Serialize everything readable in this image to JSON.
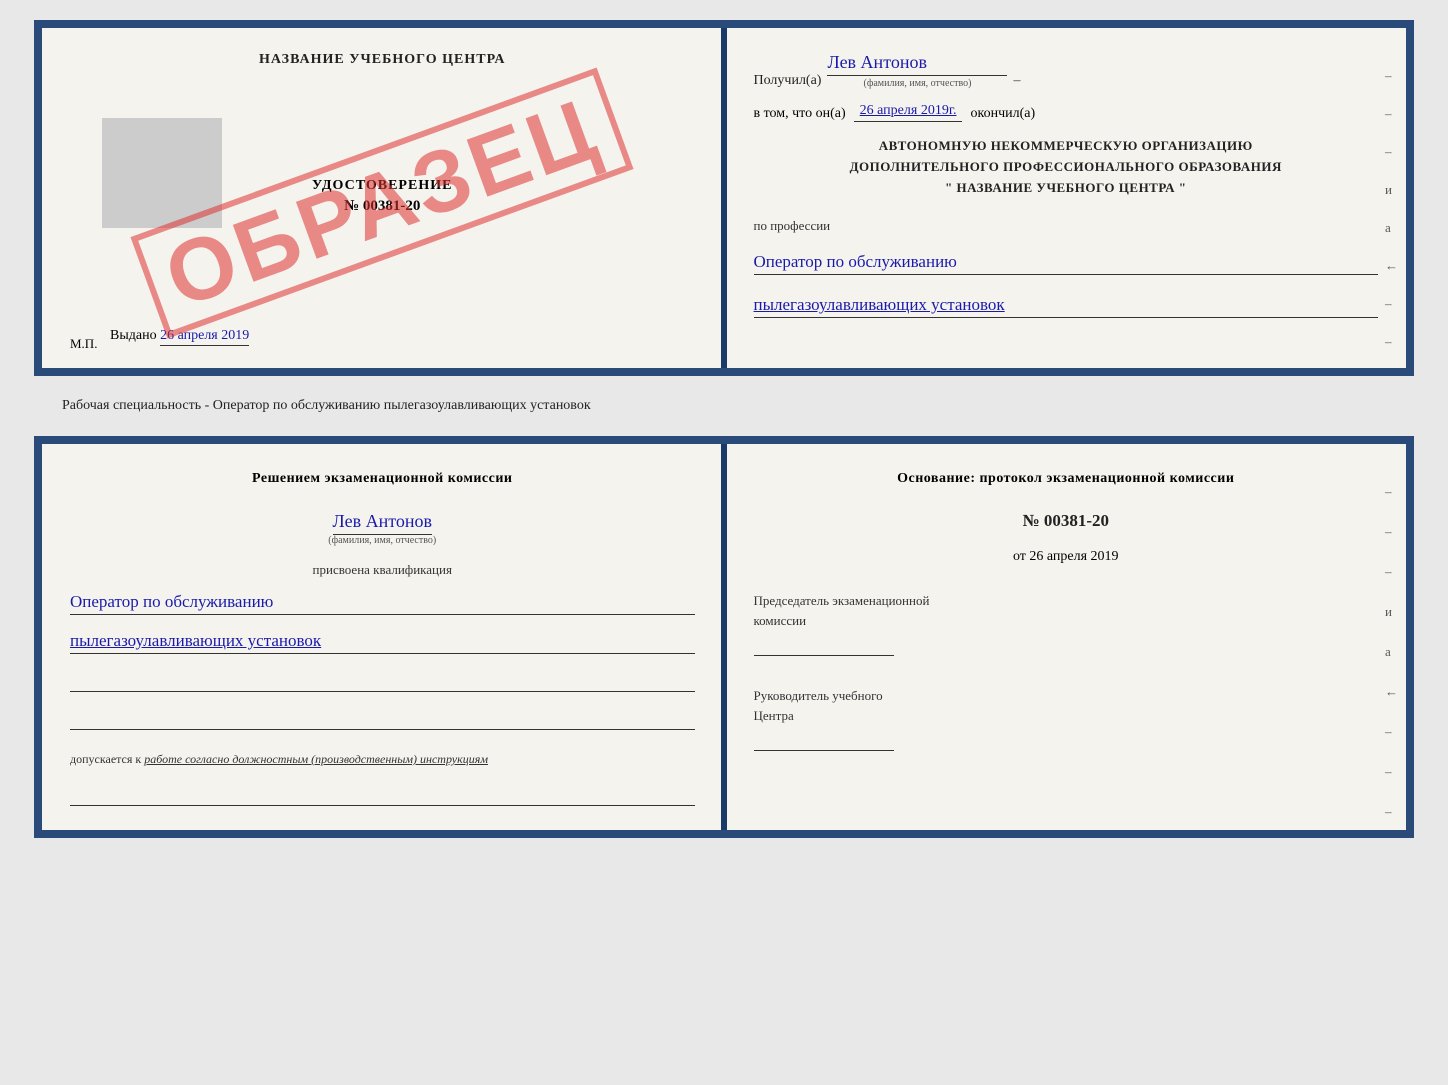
{
  "top_doc": {
    "left": {
      "school_name": "НАЗВАНИЕ УЧЕБНОГО ЦЕНТРА",
      "udostoverenie_title": "УДОСТОВЕРЕНИЕ",
      "number": "№ 00381-20",
      "vydano_label": "Выдано",
      "vydano_date": "26 апреля 2019",
      "mp": "М.П.",
      "stamp": "ОБРАЗЕЦ"
    },
    "right": {
      "poluchil_label": "Получил(а)",
      "name_handwritten": "Лев Антонов",
      "fio_sublabel": "(фамилия, имя, отчество)",
      "dash": "–",
      "vtom_label": "в том, что он(а)",
      "date_handwritten": "26 апреля 2019г.",
      "okonchil_label": "окончил(а)",
      "org_line1": "АВТОНОМНУЮ НЕКОММЕРЧЕСКУЮ ОРГАНИЗАЦИЮ",
      "org_line2": "ДОПОЛНИТЕЛЬНОГО ПРОФЕССИОНАЛЬНОГО ОБРАЗОВАНИЯ",
      "org_line3": "\"  НАЗВАНИЕ УЧЕБНОГО ЦЕНТРА  \"",
      "po_professii": "по профессии",
      "profession_line1": "Оператор по обслуживанию",
      "profession_line2": "пылегазоулавливающих установок",
      "side_dashes": [
        "–",
        "–",
        "–",
        "и",
        "а",
        "←",
        "–",
        "–",
        "–"
      ]
    }
  },
  "middle_label": "Рабочая специальность - Оператор по обслуживанию пылегазоулавливающих установок",
  "bottom_doc": {
    "left": {
      "reshen_title": "Решением экзаменационной комиссии",
      "fio_handwritten": "Лев Антонов",
      "fio_sublabel": "(фамилия, имя, отчество)",
      "prisvoena": "присвоена квалификация",
      "kvalif_line1": "Оператор по обслуживанию",
      "kvalif_line2": "пылегазоулавливающих установок",
      "dopuskaetsya_label": "допускается к",
      "dopuskaetsya_text": "работе согласно должностным (производственным) инструкциям"
    },
    "right": {
      "osnovan_title": "Основание: протокол экзаменационной комиссии",
      "protocol_number": "№  00381-20",
      "ot_label": "от",
      "ot_date": "26 апреля 2019",
      "predsedatel_title": "Председатель экзаменационной",
      "komissii_label": "комиссии",
      "rukovoditel_title": "Руководитель учебного",
      "centra_label": "Центра",
      "side_dashes": [
        "–",
        "–",
        "–",
        "и",
        "а",
        "←",
        "–",
        "–",
        "–"
      ]
    }
  }
}
